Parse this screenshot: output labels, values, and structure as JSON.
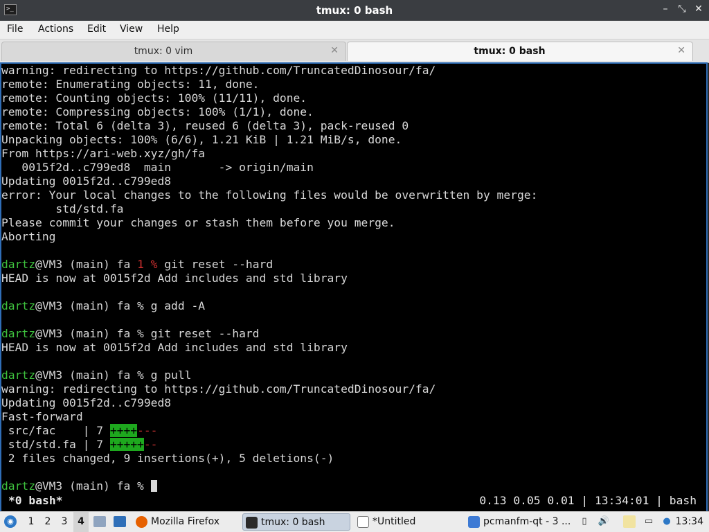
{
  "window": {
    "title": "tmux: 0 bash",
    "buttons": [
      "–",
      "⤡",
      "✕"
    ]
  },
  "menu": [
    "File",
    "Actions",
    "Edit",
    "View",
    "Help"
  ],
  "tabs": [
    {
      "label": "tmux: 0 vim",
      "active": false
    },
    {
      "label": "tmux: 0 bash",
      "active": true
    }
  ],
  "terminal": {
    "lines": [
      [
        {
          "t": "warning: redirecting to https://github.com/TruncatedDinosour/fa/"
        }
      ],
      [
        {
          "t": "remote: Enumerating objects: 11, done."
        }
      ],
      [
        {
          "t": "remote: Counting objects: 100% (11/11), done."
        }
      ],
      [
        {
          "t": "remote: Compressing objects: 100% (1/1), done."
        }
      ],
      [
        {
          "t": "remote: Total 6 (delta 3), reused 6 (delta 3), pack-reused 0"
        }
      ],
      [
        {
          "t": "Unpacking objects: 100% (6/6), 1.21 KiB | 1.21 MiB/s, done."
        }
      ],
      [
        {
          "t": "From https://ari-web.xyz/gh/fa"
        }
      ],
      [
        {
          "t": "   0015f2d..c799ed8  main       -> origin/main"
        }
      ],
      [
        {
          "t": "Updating 0015f2d..c799ed8"
        }
      ],
      [
        {
          "t": "error: Your local changes to the following files would be overwritten by merge:"
        }
      ],
      [
        {
          "t": "        std/std.fa"
        }
      ],
      [
        {
          "t": "Please commit your changes or stash them before you merge."
        }
      ],
      [
        {
          "t": "Aborting"
        }
      ],
      [
        {
          "t": ""
        }
      ],
      [
        {
          "t": "dartz",
          "c": "green"
        },
        {
          "t": "@VM3 (main) fa "
        },
        {
          "t": "1 %",
          "c": "red"
        },
        {
          "t": " git reset --hard"
        }
      ],
      [
        {
          "t": "HEAD is now at 0015f2d Add includes and std library"
        }
      ],
      [
        {
          "t": ""
        }
      ],
      [
        {
          "t": "dartz",
          "c": "green"
        },
        {
          "t": "@VM3 (main) fa % g add -A"
        }
      ],
      [
        {
          "t": ""
        }
      ],
      [
        {
          "t": "dartz",
          "c": "green"
        },
        {
          "t": "@VM3 (main) fa % git reset --hard"
        }
      ],
      [
        {
          "t": "HEAD is now at 0015f2d Add includes and std library"
        }
      ],
      [
        {
          "t": ""
        }
      ],
      [
        {
          "t": "dartz",
          "c": "green"
        },
        {
          "t": "@VM3 (main) fa % g pull"
        }
      ],
      [
        {
          "t": "warning: redirecting to https://github.com/TruncatedDinosour/fa/"
        }
      ],
      [
        {
          "t": "Updating 0015f2d..c799ed8"
        }
      ],
      [
        {
          "t": "Fast-forward"
        }
      ],
      [
        {
          "t": " src/fac    | 7 "
        },
        {
          "t": "++++",
          "c": "plus"
        },
        {
          "t": "---",
          "c": "minus"
        }
      ],
      [
        {
          "t": " std/std.fa | 7 "
        },
        {
          "t": "+++++",
          "c": "plus"
        },
        {
          "t": "--",
          "c": "minus"
        }
      ],
      [
        {
          "t": " 2 files changed, 9 insertions(+), 5 deletions(-)"
        }
      ],
      [
        {
          "t": ""
        }
      ],
      [
        {
          "t": "dartz",
          "c": "green"
        },
        {
          "t": "@VM3 (main) fa % "
        },
        {
          "t": "",
          "c": "cursor"
        }
      ]
    ],
    "status_left": "*0 bash*",
    "status_right": "0.13 0.05 0.01 | 13:34:01 | bash",
    "colors": {
      "prompt_user": "#3ec23e",
      "error_code": "#d03030",
      "diff_add_bg": "#1ea81e",
      "diff_del": "#c03030"
    }
  },
  "taskbar": {
    "workspaces": [
      "1",
      "2",
      "3",
      "4"
    ],
    "active_workspace": "4",
    "tasks": [
      {
        "label": "Mozilla Firefox",
        "icon": "firefox-icon",
        "active": false
      },
      {
        "label": "tmux: 0 bash",
        "icon": "terminal-icon",
        "active": true
      },
      {
        "label": "*Untitled",
        "icon": "text-editor-icon",
        "active": false
      },
      {
        "label": "pcmanfm-qt - 3 ...",
        "icon": "folder-icon",
        "active": false
      }
    ],
    "clock": "13:34"
  }
}
